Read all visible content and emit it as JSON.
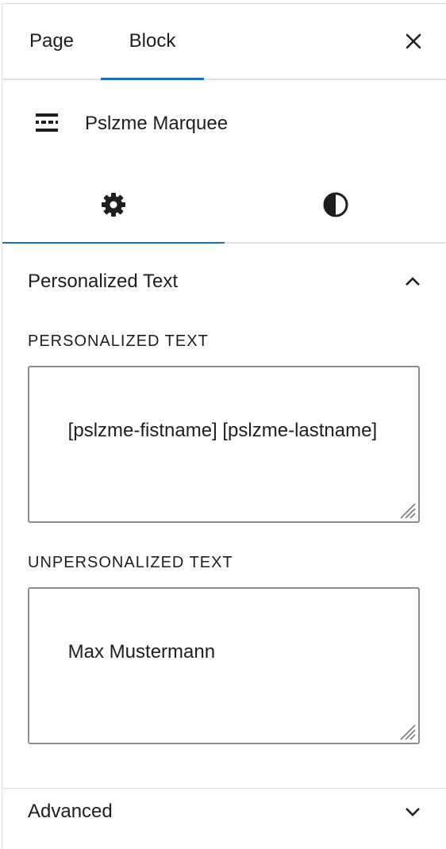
{
  "top_tabs": {
    "page": "Page",
    "block": "Block"
  },
  "block_card": {
    "title": "Pslzme Marquee"
  },
  "inspector_tabs": {
    "settings_icon": "gear-icon",
    "styles_icon": "contrast-icon"
  },
  "personalized_section": {
    "title": "Personalized Text",
    "personalized_label": "PERSONALIZED TEXT",
    "personalized_value": "[pslzme-fistname] [pslzme-lastname]",
    "unpersonalized_label": "UNPERSONALIZED TEXT",
    "unpersonalized_value": "Max Mustermann"
  },
  "advanced_section": {
    "title": "Advanced"
  },
  "colors": {
    "accent": "#1a6fb0",
    "text": "#1e1e1e",
    "border": "#8c8c8c"
  }
}
